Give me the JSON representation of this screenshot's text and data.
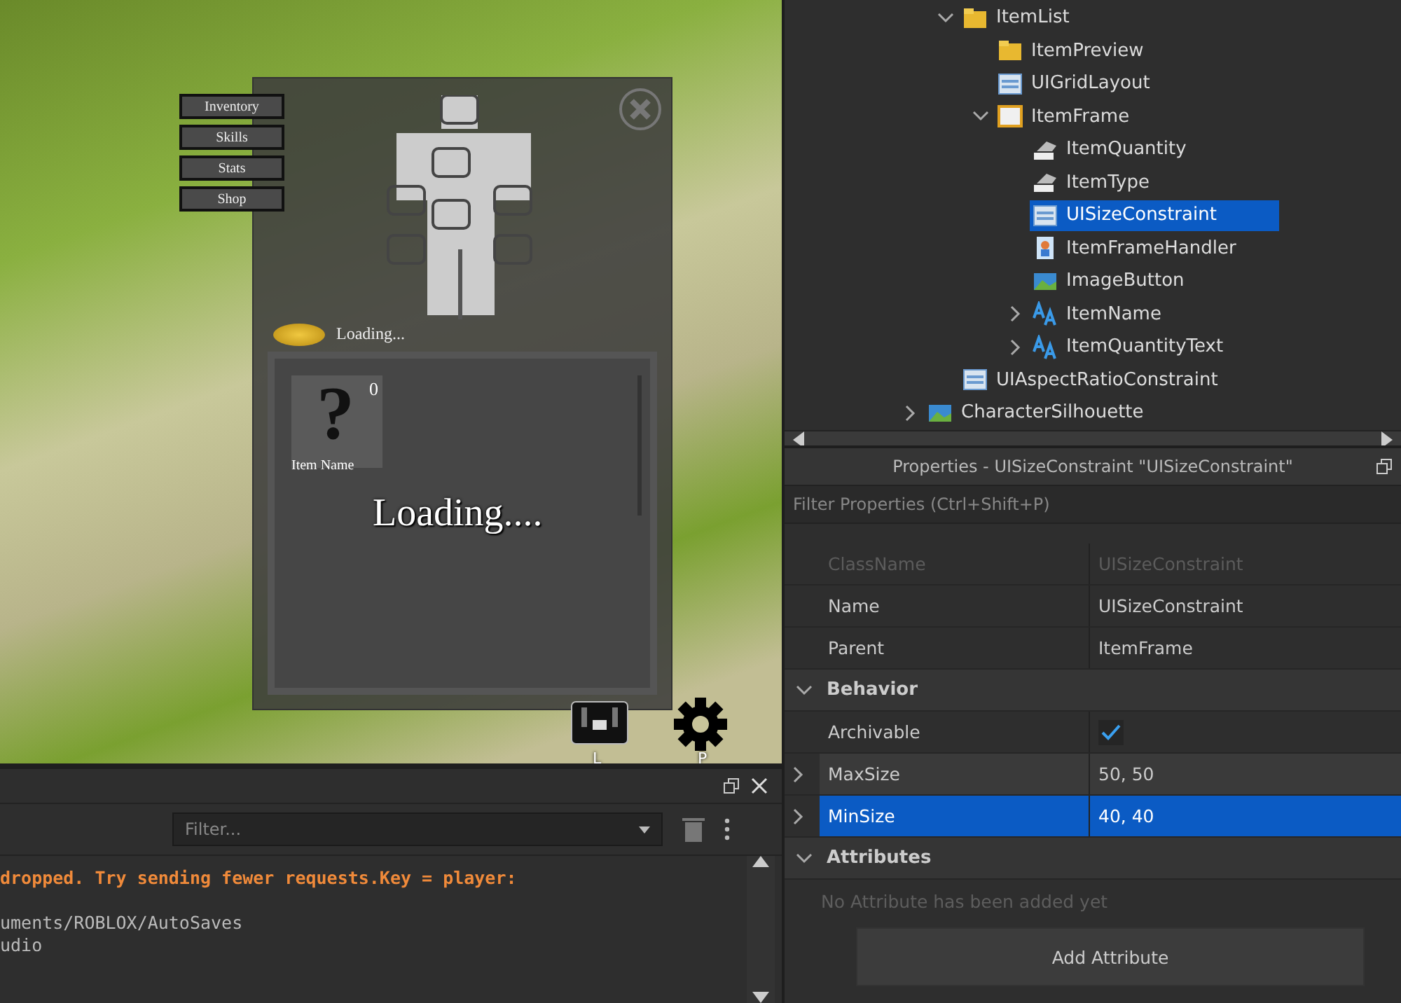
{
  "game_view": {
    "menu_buttons": [
      {
        "label": "Inventory"
      },
      {
        "label": "Skills"
      },
      {
        "label": "Stats"
      },
      {
        "label": "Shop"
      }
    ],
    "inventory": {
      "currency": "Loading...",
      "slots": [
        {
          "symbol": "?",
          "quantity": "0",
          "name": "Item Name"
        }
      ],
      "status": "Loading...."
    },
    "hotkeys": [
      {
        "kind": "bag",
        "key": "L"
      },
      {
        "kind": "gear",
        "key": "P"
      }
    ]
  },
  "output": {
    "filter": {
      "placeholder": "Filter..."
    },
    "lines": [
      {
        "kind": "warning",
        "text": "dropped. Try sending fewer requests.Key = player:"
      },
      {
        "kind": "info",
        "text": "uments/ROBLOX/AutoSaves"
      },
      {
        "kind": "info",
        "text": "udio"
      }
    ]
  },
  "explorer": {
    "tree": [
      {
        "name": "ItemList",
        "kind": "folder",
        "expanded": true,
        "selected": false,
        "children": [
          {
            "name": "ItemPreview",
            "kind": "folder",
            "selected": false
          },
          {
            "name": "UIGridLayout",
            "kind": "layout",
            "selected": false
          },
          {
            "name": "ItemFrame",
            "kind": "frame",
            "expanded": true,
            "selected": false,
            "children": [
              {
                "name": "ItemQuantity",
                "kind": "value",
                "selected": false
              },
              {
                "name": "ItemType",
                "kind": "value",
                "selected": false
              },
              {
                "name": "UISizeConstraint",
                "kind": "layout",
                "selected": true
              },
              {
                "name": "ItemFrameHandler",
                "kind": "script",
                "selected": false
              },
              {
                "name": "ImageButton",
                "kind": "image",
                "selected": false
              },
              {
                "name": "ItemName",
                "kind": "text",
                "expanded": false,
                "selected": false
              },
              {
                "name": "ItemQuantityText",
                "kind": "text",
                "expanded": false,
                "selected": false
              }
            ]
          }
        ]
      },
      {
        "name": "UIAspectRatioConstraint",
        "kind": "layout",
        "selected": false
      }
    ],
    "parent_level_items": [
      {
        "name": "CharacterSilhouette",
        "kind": "image",
        "expanded": false,
        "selected": false
      }
    ]
  },
  "properties": {
    "title": "Properties - UISizeConstraint \"UISizeConstraint\"",
    "filter": {
      "placeholder": "Filter Properties (Ctrl+Shift+P)"
    },
    "rows": [
      {
        "kind": "text",
        "name": "ClassName",
        "value": "UISizeConstraint",
        "disabled": true,
        "selected": false
      },
      {
        "kind": "text",
        "name": "Name",
        "value": "UISizeConstraint",
        "disabled": false,
        "selected": false
      },
      {
        "kind": "text",
        "name": "Parent",
        "value": "ItemFrame",
        "disabled": false,
        "selected": false
      }
    ],
    "sections": [
      {
        "title": "Behavior",
        "expanded": true,
        "rows": [
          {
            "kind": "checkbox",
            "name": "Archivable",
            "checked": true,
            "disabled": false,
            "selected": false
          },
          {
            "kind": "text",
            "name": "MaxSize",
            "value": "50, 50",
            "expandable": true,
            "disabled": false,
            "selected": false
          },
          {
            "kind": "text",
            "name": "MinSize",
            "value": "40, 40",
            "expandable": true,
            "disabled": false,
            "selected": true
          }
        ]
      },
      {
        "title": "Attributes",
        "expanded": true,
        "note": "No Attribute has been added yet"
      }
    ],
    "add_button": "Add Attribute"
  }
}
